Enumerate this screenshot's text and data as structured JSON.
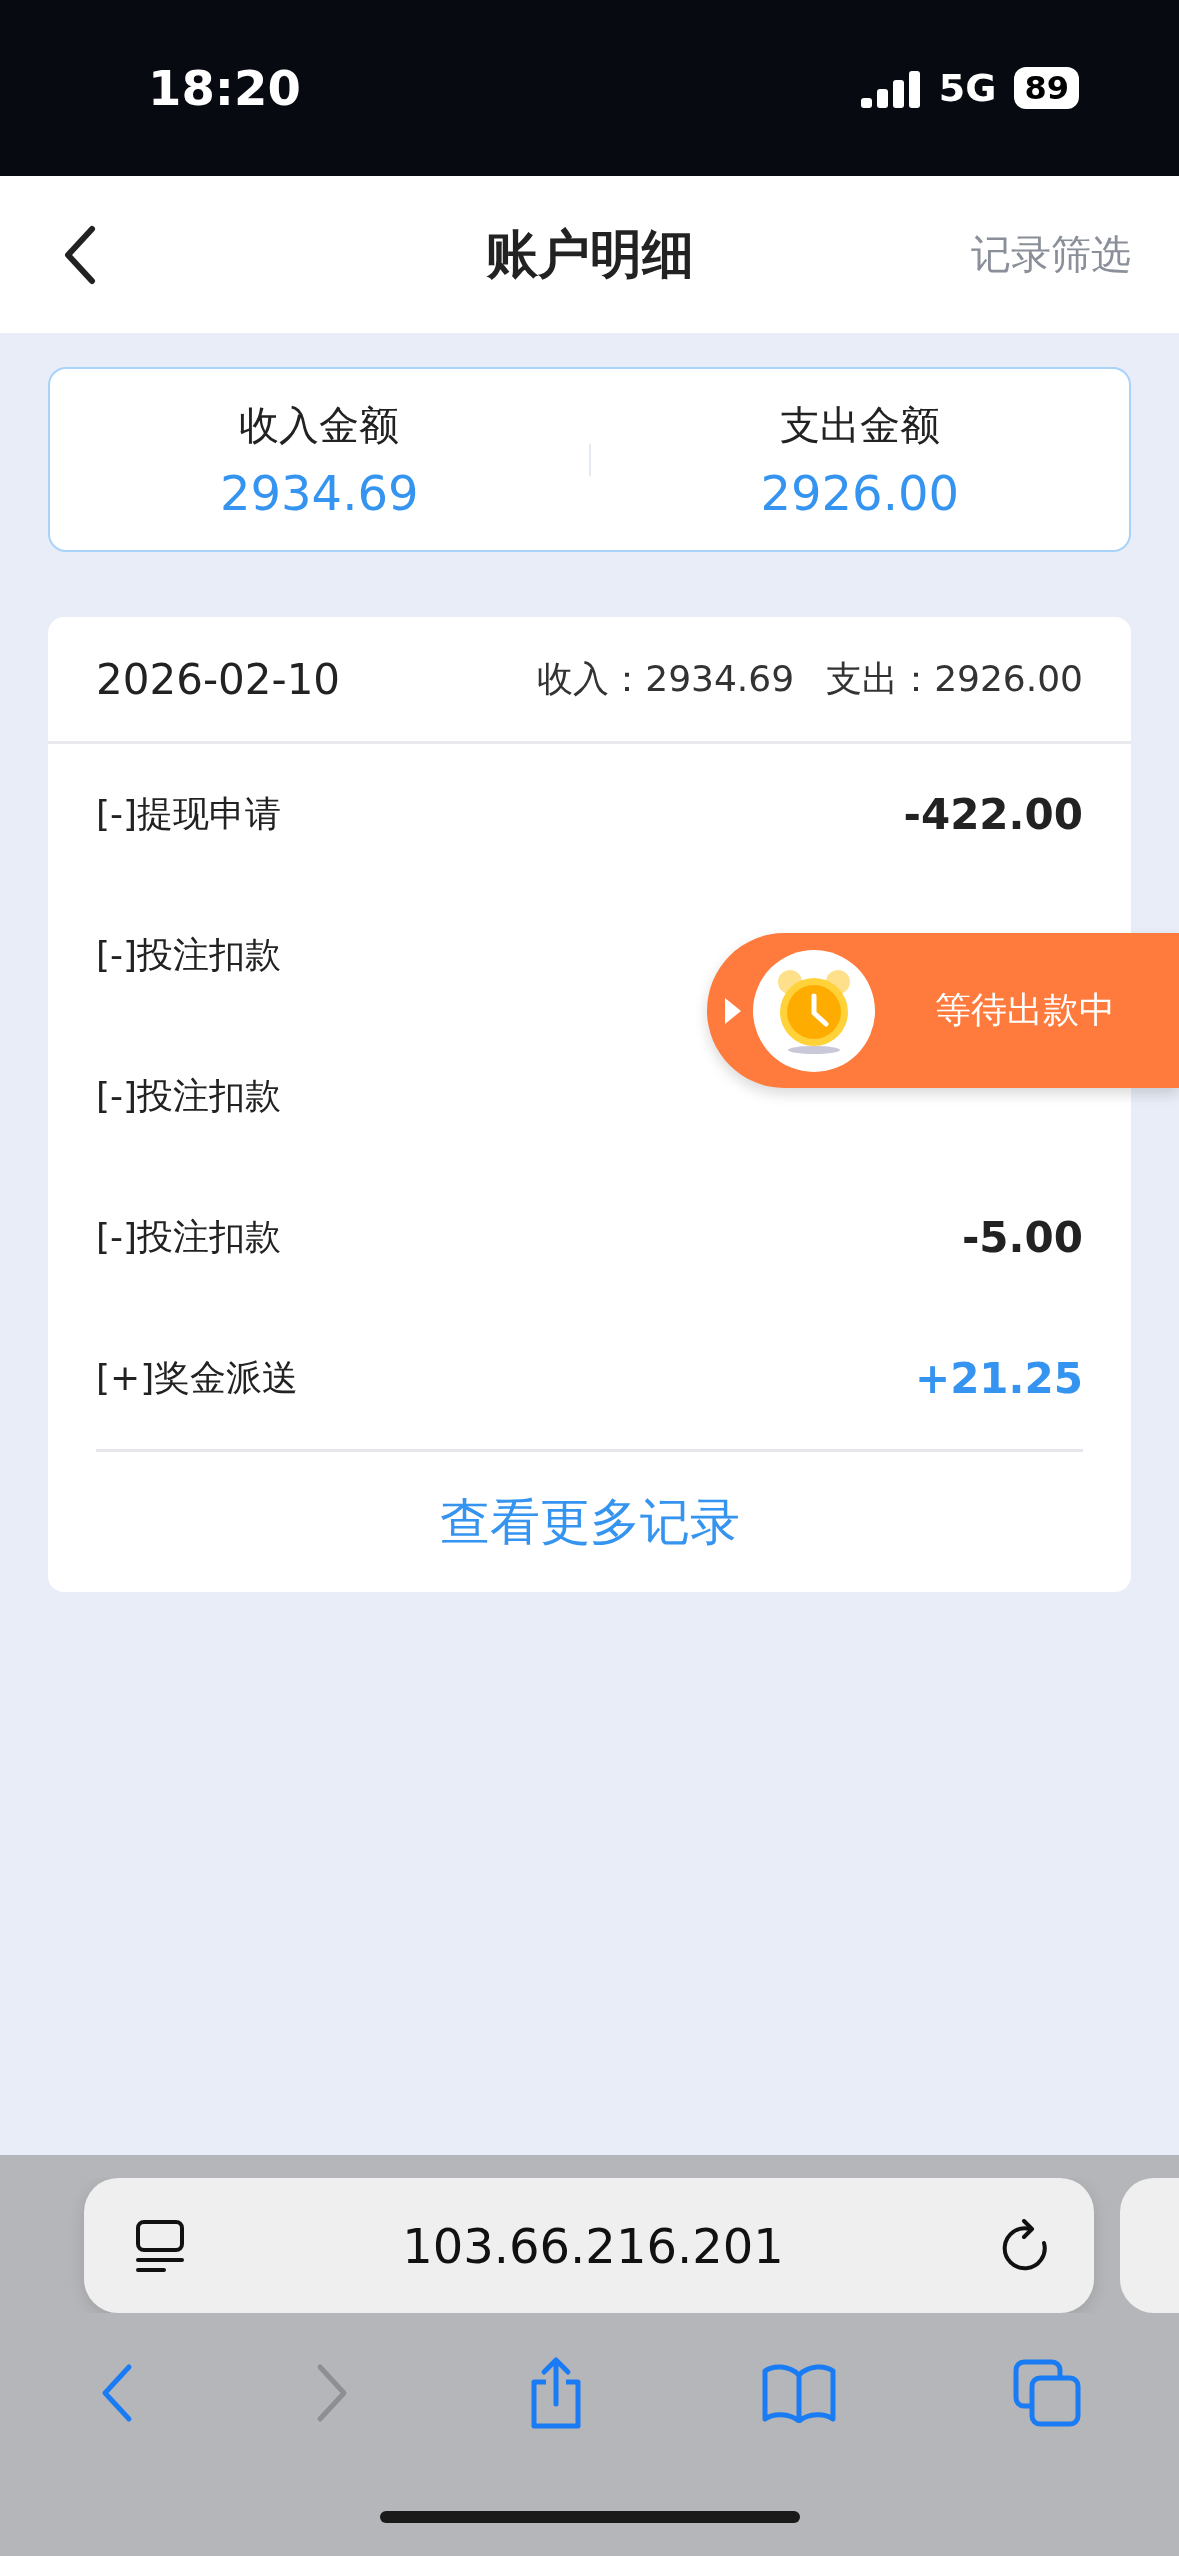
{
  "status_bar": {
    "time": "18:20",
    "network": "5G",
    "battery": "89"
  },
  "header": {
    "title": "账户明细",
    "action": "记录筛选"
  },
  "summary": [
    {
      "label": "收入金额",
      "value": "2934.69"
    },
    {
      "label": "支出金额",
      "value": "2926.00"
    }
  ],
  "day": {
    "date": "2026-02-10",
    "income_label": "收入：",
    "income": "2934.69",
    "expense_label": "支出：",
    "expense": "2926.00",
    "rows": [
      {
        "label": "[-]提现申请",
        "amount": "-422.00",
        "kind": "debit"
      },
      {
        "label": "[-]投注扣款"
      },
      {
        "label": "[-]投注扣款"
      },
      {
        "label": "[-]投注扣款",
        "amount": "-5.00",
        "kind": "debit"
      },
      {
        "label": "[+]奖金派送",
        "amount": "+21.25",
        "kind": "credit"
      }
    ],
    "more": "查看更多记录"
  },
  "float_badge": {
    "text": "等待出款中"
  },
  "browser": {
    "url": "103.66.216.201",
    "back_disabled": false,
    "forward_disabled": true
  }
}
